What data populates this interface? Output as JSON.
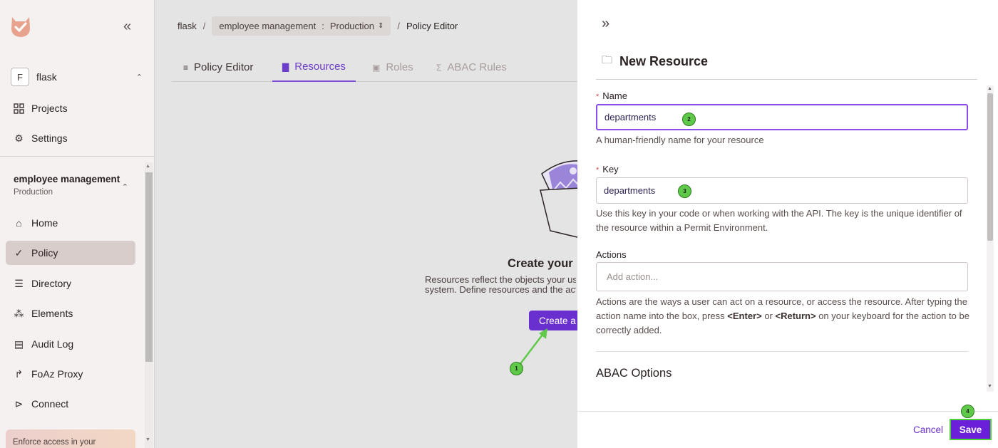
{
  "sidebar": {
    "org": {
      "badge": "F",
      "name": "flask"
    },
    "nav_top": [
      {
        "label": "Projects",
        "icon": "grid-icon"
      },
      {
        "label": "Settings",
        "icon": "gear-icon"
      }
    ],
    "project": {
      "name": "employee management",
      "env": "Production"
    },
    "nav": [
      {
        "label": "Home",
        "icon": "home-icon"
      },
      {
        "label": "Policy",
        "icon": "checks-icon",
        "active": true
      },
      {
        "label": "Directory",
        "icon": "directory-icon"
      },
      {
        "label": "Elements",
        "icon": "elements-icon"
      },
      {
        "label": "Audit Log",
        "icon": "audit-log-icon"
      },
      {
        "label": "FoAz Proxy",
        "icon": "proxy-icon"
      },
      {
        "label": "Connect",
        "icon": "terminal-icon"
      }
    ],
    "promo_text": "Enforce access in your"
  },
  "breadcrumb": {
    "workspace": "flask",
    "project": "employee management",
    "colon": ":",
    "env": "Production",
    "current": "Policy Editor"
  },
  "tabs": [
    {
      "label": "Policy Editor",
      "icon": "list-check-icon"
    },
    {
      "label": "Resources",
      "icon": "folder-icon",
      "active": true
    },
    {
      "label": "Roles",
      "icon": "role-icon",
      "disabled": true
    },
    {
      "label": "ABAC Rules",
      "icon": "sigma-icon",
      "disabled": true
    }
  ],
  "empty_state": {
    "title": "Create your first resource",
    "desc_line1": "Resources reflect the objects your users can act on in your",
    "desc_line2": "system. Define resources and the actions they support.",
    "button": "Create a Resource"
  },
  "drawer": {
    "title": "New Resource",
    "name_label": "Name",
    "name_value": "departments",
    "name_help": "A human-friendly name for your resource",
    "key_label": "Key",
    "key_value": "departments",
    "key_help": "Use this key in your code or when working with the API. The key is the unique identifier of the resource within a Permit Environment.",
    "actions_label": "Actions",
    "actions_placeholder": "Add action...",
    "actions_help_1": "Actions are the ways a user can act on a resource, or access the resource. After typing the action name into the box, press ",
    "actions_help_enter": "<Enter>",
    "actions_help_or": " or ",
    "actions_help_return": "<Return>",
    "actions_help_2": " on your keyboard for the action to be correctly added.",
    "abac_heading": "ABAC Options",
    "cancel": "Cancel",
    "save": "Save"
  },
  "markers": [
    "1",
    "2",
    "3",
    "4"
  ],
  "colors": {
    "accent": "#6a2fcf",
    "marker": "#5fc94a",
    "focus_border": "#8a4de8"
  }
}
